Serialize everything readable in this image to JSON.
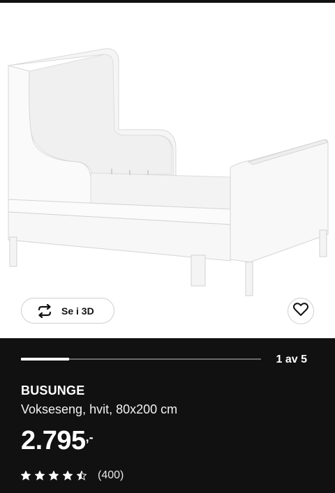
{
  "product": {
    "name": "BUSUNGE",
    "description": "Vokseseng, hvit, 80x200 cm",
    "price_amount": "2.795",
    "price_suffix": ",-"
  },
  "gallery": {
    "view_3d_label": "Se i 3D",
    "counter_text": "1 av 5",
    "current_index": 1,
    "total_images": 5,
    "progress_fraction": 0.2
  },
  "rating": {
    "stars": 4.5,
    "max_stars": 5,
    "count_text": "(400)"
  },
  "colors": {
    "panel_background": "#111111",
    "text": "#ffffff",
    "progress_track": "#6b6b6b"
  },
  "icons": {
    "view_3d": "rotate-arrows-icon",
    "favourite": "heart-icon",
    "rating": "star-icon"
  }
}
